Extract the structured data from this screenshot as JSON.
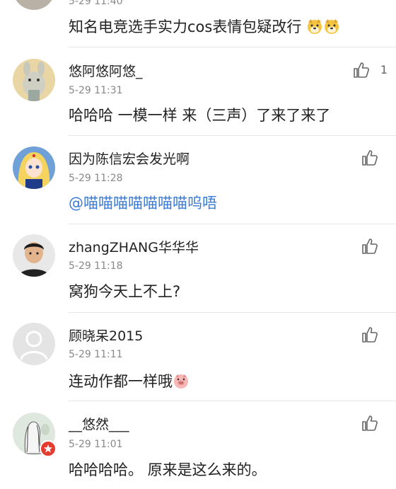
{
  "top": {
    "time_partial": "5-29 11:40",
    "text": "知名电竞选手实力cos表情包疑改行"
  },
  "comments": [
    {
      "name": "悠阿悠阿悠_",
      "time": "5-29 11:31",
      "text": "哈哈哈 一模一样 来（三声）了来了来了",
      "likes": "1"
    },
    {
      "name": "因为陈信宏会发光啊",
      "time": "5-29 11:28",
      "text": "@喵喵喵喵喵喵喵呜唔"
    },
    {
      "name": "zhangZHANG华华华",
      "time": "5-29 11:18",
      "text": "窝狗今天上不上?"
    },
    {
      "name": "顾晓呆2015",
      "time": "5-29 11:11",
      "text": "连动作都一样哦"
    },
    {
      "name": "__悠然___",
      "time": "5-29 11:01",
      "text": "哈哈哈哈。 原来是这么来的。"
    }
  ],
  "icons": {
    "like": "thumbs-up-icon",
    "dog_emoji": "dog-face-emoji-icon",
    "pig_emoji": "pig-face-emoji-icon",
    "badge": "verified-badge-icon"
  },
  "colors": {
    "mention": "#3a7bd5",
    "divider": "#e6e6e6",
    "badge": "#e43d30"
  }
}
